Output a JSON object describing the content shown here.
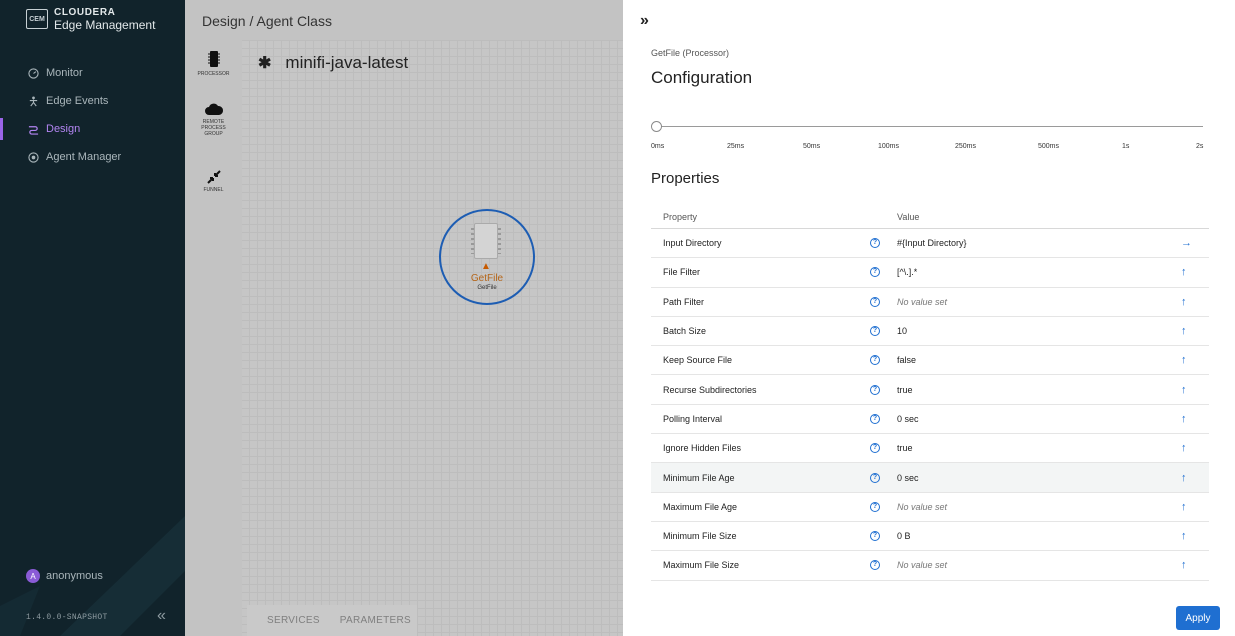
{
  "brand": {
    "badge": "CEM",
    "name_top": "CLOUDERA",
    "name_bottom": "Edge Management"
  },
  "sidebar": {
    "items": [
      {
        "label": "Monitor",
        "icon": "gauge-icon",
        "active": false
      },
      {
        "label": "Edge Events",
        "icon": "person-icon",
        "active": false
      },
      {
        "label": "Design",
        "icon": "design-icon",
        "active": true
      },
      {
        "label": "Agent Manager",
        "icon": "agent-icon",
        "active": false
      }
    ],
    "user": {
      "avatar_letter": "A",
      "name": "anonymous"
    },
    "version": "1.4.0.0-SNAPSHOT",
    "collapse_icon": "double-chevron-left-icon"
  },
  "header": {
    "title": "Design / Agent Class"
  },
  "palette": {
    "processor_label": "PROCESSOR",
    "rpg_label_1": "REMOTE",
    "rpg_label_2": "PROCESS",
    "rpg_label_3": "GROUP",
    "funnel_label": "FUNNEL"
  },
  "flow": {
    "name": "minifi-java-latest"
  },
  "processor": {
    "name": "GetFile",
    "type": "GetFile",
    "warning": "warning-icon"
  },
  "bottom_tabs": {
    "services": "SERVICES",
    "parameters": "PARAMETERS"
  },
  "panel": {
    "expand_icon": "double-chevron-right-icon",
    "subtitle": "GetFile (Processor)",
    "title": "Configuration",
    "slider": {
      "value": "0ms",
      "ticks": [
        "0ms",
        "25ms",
        "50ms",
        "100ms",
        "250ms",
        "500ms",
        "1s",
        "2s"
      ]
    },
    "properties_title": "Properties",
    "columns": {
      "property": "Property",
      "value": "Value"
    },
    "properties": [
      {
        "name": "Input Directory",
        "value": "#{Input Directory}",
        "empty": false,
        "action": "→"
      },
      {
        "name": "File Filter",
        "value": "[^\\.].*",
        "empty": false,
        "action": "↑"
      },
      {
        "name": "Path Filter",
        "value": "No value set",
        "empty": true,
        "action": "↑"
      },
      {
        "name": "Batch Size",
        "value": "10",
        "empty": false,
        "action": "↑"
      },
      {
        "name": "Keep Source File",
        "value": "false",
        "empty": false,
        "action": "↑"
      },
      {
        "name": "Recurse Subdirectories",
        "value": "true",
        "empty": false,
        "action": "↑"
      },
      {
        "name": "Polling Interval",
        "value": "0 sec",
        "empty": false,
        "action": "↑"
      },
      {
        "name": "Ignore Hidden Files",
        "value": "true",
        "empty": false,
        "action": "↑"
      },
      {
        "name": "Minimum File Age",
        "value": "0 sec",
        "empty": false,
        "action": "↑"
      },
      {
        "name": "Maximum File Age",
        "value": "No value set",
        "empty": true,
        "action": "↑"
      },
      {
        "name": "Minimum File Size",
        "value": "0 B",
        "empty": false,
        "action": "↑"
      },
      {
        "name": "Maximum File Size",
        "value": "No value set",
        "empty": true,
        "action": "↑"
      }
    ],
    "apply_label": "Apply"
  },
  "colors": {
    "sidebar_bg": "#11232b",
    "accent": "#9a64e8",
    "primary": "#1f6fd1",
    "processor_ring": "#1d5db3"
  }
}
